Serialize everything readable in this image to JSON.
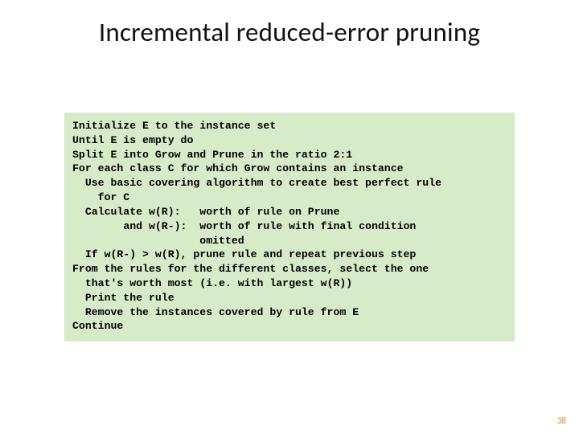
{
  "title": "Incremental reduced-error pruning",
  "code": "Initialize E to the instance set\nUntil E is empty do\nSplit E into Grow and Prune in the ratio 2:1\nFor each class C for which Grow contains an instance\n  Use basic covering algorithm to create best perfect rule\n    for C\n  Calculate w(R):   worth of rule on Prune\n        and w(R-):  worth of rule with final condition\n                    omitted\n  If w(R-) > w(R), prune rule and repeat previous step\nFrom the rules for the different classes, select the one\n  that's worth most (i.e. with largest w(R))\n  Print the rule\n  Remove the instances covered by rule from E\nContinue",
  "page_number": "38"
}
